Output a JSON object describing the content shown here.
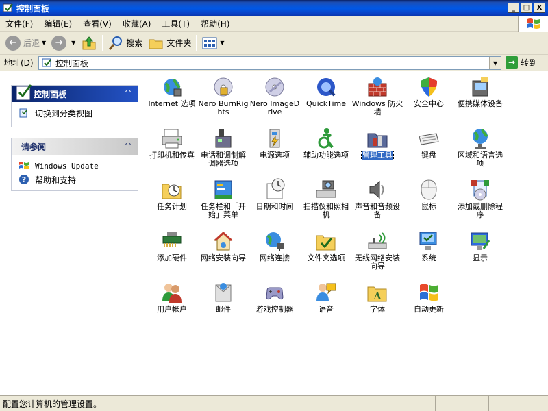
{
  "window": {
    "title": "控制面板"
  },
  "titlebar_buttons": {
    "min": "_",
    "max": "□",
    "close": "X"
  },
  "menu": [
    "文件(F)",
    "编辑(E)",
    "查看(V)",
    "收藏(A)",
    "工具(T)",
    "帮助(H)"
  ],
  "toolbar": {
    "back": "后退",
    "search": "搜索",
    "folders": "文件夹"
  },
  "address": {
    "label": "地址(D)",
    "value": "控制面板",
    "go": "转到"
  },
  "left_pane": {
    "cp_title": "控制面板",
    "switch_view": "切换到分类视图",
    "see_also_title": "请参阅",
    "see_also_items": [
      "Windows Update",
      "帮助和支持"
    ]
  },
  "icons": [
    {
      "label": "Internet 选项",
      "icon": "globe-settings-icon"
    },
    {
      "label": "Nero BurnRights",
      "icon": "nero-lock-icon"
    },
    {
      "label": "Nero ImageDrive",
      "icon": "nero-drive-icon"
    },
    {
      "label": "QuickTime",
      "icon": "quicktime-icon"
    },
    {
      "label": "Windows 防火墙",
      "icon": "firewall-icon"
    },
    {
      "label": "安全中心",
      "icon": "shield-icon"
    },
    {
      "label": "便携媒体设备",
      "icon": "portable-device-icon"
    },
    {
      "label": "打印机和传真",
      "icon": "printer-icon"
    },
    {
      "label": "电话和调制解调器选项",
      "icon": "phone-modem-icon"
    },
    {
      "label": "电源选项",
      "icon": "power-icon"
    },
    {
      "label": "辅助功能选项",
      "icon": "accessibility-icon"
    },
    {
      "label": "管理工具",
      "icon": "admin-tools-icon",
      "selected": true
    },
    {
      "label": "键盘",
      "icon": "keyboard-icon"
    },
    {
      "label": "区域和语言选项",
      "icon": "globe-region-icon"
    },
    {
      "label": "任务计划",
      "icon": "scheduled-tasks-icon"
    },
    {
      "label": "任务栏和「开始」菜单",
      "icon": "taskbar-icon"
    },
    {
      "label": "日期和时间",
      "icon": "clock-icon"
    },
    {
      "label": "扫描仪和照相机",
      "icon": "scanner-camera-icon"
    },
    {
      "label": "声音和音频设备",
      "icon": "speaker-icon"
    },
    {
      "label": "鼠标",
      "icon": "mouse-icon"
    },
    {
      "label": "添加或删除程序",
      "icon": "add-remove-programs-icon"
    },
    {
      "label": "添加硬件",
      "icon": "add-hardware-icon"
    },
    {
      "label": "网络安装向导",
      "icon": "network-wizard-icon"
    },
    {
      "label": "网络连接",
      "icon": "network-connections-icon"
    },
    {
      "label": "文件夹选项",
      "icon": "folder-options-icon"
    },
    {
      "label": "无线网络安装向导",
      "icon": "wireless-wizard-icon"
    },
    {
      "label": "系统",
      "icon": "system-icon"
    },
    {
      "label": "显示",
      "icon": "display-icon"
    },
    {
      "label": "用户帐户",
      "icon": "user-accounts-icon"
    },
    {
      "label": "邮件",
      "icon": "mail-icon"
    },
    {
      "label": "游戏控制器",
      "icon": "game-controller-icon"
    },
    {
      "label": "语音",
      "icon": "speech-icon"
    },
    {
      "label": "字体",
      "icon": "fonts-icon"
    },
    {
      "label": "自动更新",
      "icon": "windows-update-icon"
    }
  ],
  "status": {
    "text": "配置您计算机的管理设置。"
  },
  "colors": {
    "title_blue": "#0058e6",
    "selection": "#316ac5",
    "go_green": "#2f9e3a"
  }
}
